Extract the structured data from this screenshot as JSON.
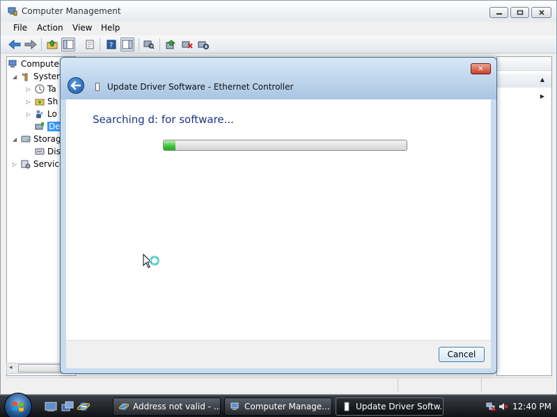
{
  "main_window": {
    "title": "Computer Management",
    "menu": [
      "File",
      "Action",
      "View",
      "Help"
    ],
    "tree": [
      {
        "label": "Computer",
        "level": 0,
        "expanded": true
      },
      {
        "label": "System",
        "level": 1,
        "expanded": true
      },
      {
        "label": "Ta",
        "level": 2,
        "expanded": false
      },
      {
        "label": "Sh",
        "level": 2,
        "expanded": false
      },
      {
        "label": "Lo",
        "level": 2,
        "expanded": false
      },
      {
        "label": "De",
        "level": 2,
        "selected": true
      },
      {
        "label": "Storag",
        "level": 1,
        "expanded": true
      },
      {
        "label": "Dis",
        "level": 2
      },
      {
        "label": "Service",
        "level": 1,
        "expanded": false
      }
    ]
  },
  "dialog": {
    "title": "Update Driver Software - Ethernet Controller",
    "heading": "Searching d: for software...",
    "progress": 0.05,
    "cancel_label": "Cancel",
    "close_glyph": "✕"
  },
  "taskbar": {
    "buttons": [
      {
        "label": "Address not valid - ...",
        "icon": "ie-icon",
        "active": false
      },
      {
        "label": "Computer Manage...",
        "icon": "computer-management-icon",
        "active": false
      },
      {
        "label": "Update Driver Softw...",
        "icon": "device-icon",
        "active": true
      }
    ],
    "clock": "12:40 PM"
  },
  "colors": {
    "dialog_heading": "#1e3287",
    "progress_fill": "#3ec43b",
    "selection": "#3399ff"
  }
}
